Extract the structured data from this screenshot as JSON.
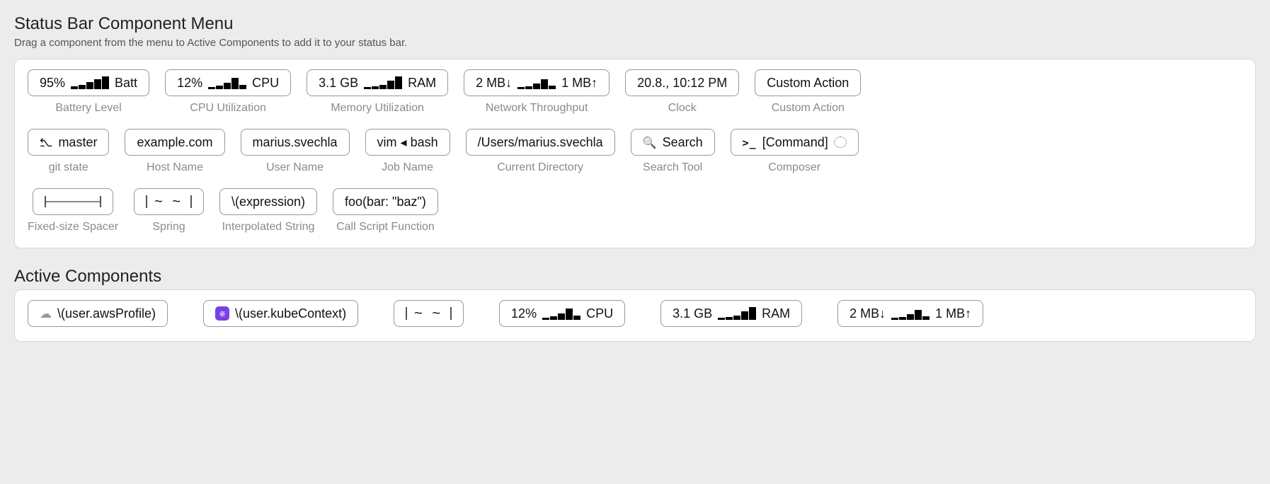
{
  "menu": {
    "title": "Status Bar Component Menu",
    "desc": "Drag a component from the menu to Active Components to add it to your status bar.",
    "row1": [
      {
        "name": "battery",
        "label": "Battery Level",
        "left": "95%",
        "right": "Batt",
        "bars": "up"
      },
      {
        "name": "cpu",
        "label": "CPU Utilization",
        "left": "12%",
        "right": "CPU",
        "bars": "A"
      },
      {
        "name": "ram",
        "label": "Memory Utilization",
        "left": "3.1 GB",
        "right": "RAM",
        "bars": "B"
      },
      {
        "name": "net",
        "label": "Network Throughput",
        "left": "2 MB↓",
        "right": "1 MB↑",
        "bars": "C"
      },
      {
        "name": "clock",
        "label": "Clock",
        "text": "20.8., 10:12 PM"
      },
      {
        "name": "custom",
        "label": "Custom Action",
        "text": "Custom Action"
      }
    ],
    "row2": [
      {
        "name": "git",
        "label": "git state",
        "icon": "branch",
        "text": "master"
      },
      {
        "name": "host",
        "label": "Host Name",
        "text": "example.com"
      },
      {
        "name": "user",
        "label": "User Name",
        "text": "marius.svechla"
      },
      {
        "name": "job",
        "label": "Job Name",
        "text": "vim ◂ bash"
      },
      {
        "name": "cwd",
        "label": "Current Directory",
        "text": "/Users/marius.svechla"
      },
      {
        "name": "search",
        "label": "Search Tool",
        "icon": "search",
        "text": "Search"
      },
      {
        "name": "composer",
        "label": "Composer",
        "icon": "terminal",
        "text": "[Command]",
        "tail": "bubble"
      }
    ],
    "row3": [
      {
        "name": "spacer",
        "label": "Fixed-size Spacer",
        "glyph": "spacer"
      },
      {
        "name": "spring",
        "label": "Spring",
        "glyph": "spring"
      },
      {
        "name": "interp",
        "label": "Interpolated String",
        "text": "\\(expression)"
      },
      {
        "name": "script",
        "label": "Call Script Function",
        "text": "foo(bar: \"baz\")"
      }
    ]
  },
  "active": {
    "title": "Active Components",
    "items": [
      {
        "name": "aws",
        "icon": "cloud",
        "text": "\\(user.awsProfile)"
      },
      {
        "name": "kube",
        "icon": "kube",
        "text": "\\(user.kubeContext)"
      },
      {
        "name": "spring2",
        "glyph": "spring"
      },
      {
        "name": "cpu2",
        "left": "12%",
        "right": "CPU",
        "bars": "A"
      },
      {
        "name": "ram2",
        "left": "3.1 GB",
        "right": "RAM",
        "bars": "B"
      },
      {
        "name": "net2",
        "left": "2 MB↓",
        "right": "1 MB↑",
        "bars": "C"
      }
    ]
  }
}
